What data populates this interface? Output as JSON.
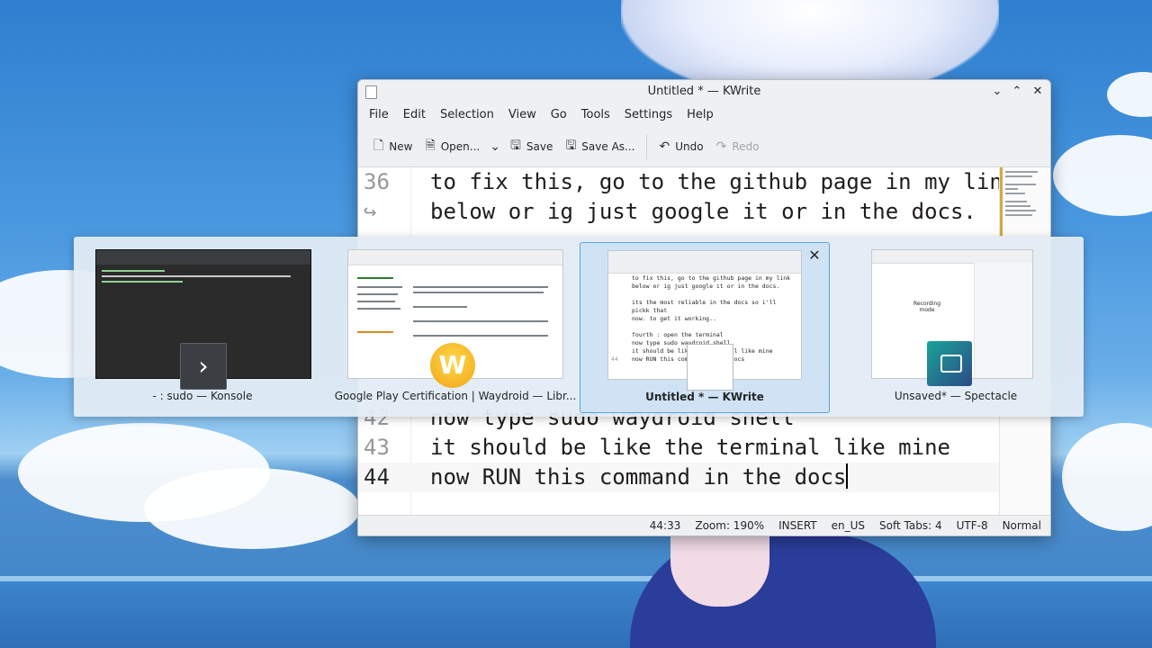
{
  "window": {
    "title": "Untitled * — KWrite",
    "menu": [
      "File",
      "Edit",
      "Selection",
      "View",
      "Go",
      "Tools",
      "Settings",
      "Help"
    ],
    "toolbar": {
      "new": "New",
      "open": "Open...",
      "save": "Save",
      "save_as": "Save As...",
      "undo": "Undo",
      "redo": "Redo"
    }
  },
  "editor": {
    "lines_top": [
      {
        "num": "36",
        "text": "to fix this, go to the github page in my link"
      },
      {
        "num": "↪",
        "text": "below or ig just google it or in the docs."
      }
    ],
    "lines_bottom": [
      {
        "num": "42",
        "text": "now type sudo waydroid shell"
      },
      {
        "num": "43",
        "text": "it should be like the terminal like mine"
      },
      {
        "num": "44",
        "text": "now RUN this command in the docs"
      }
    ]
  },
  "statusbar": {
    "position": "44:33",
    "zoom": "Zoom: 190%",
    "mode": "INSERT",
    "dictionary": "en_US",
    "tabs": "Soft Tabs: 4",
    "encoding": "UTF-8",
    "syntax": "Normal"
  },
  "switcher": {
    "tasks": [
      {
        "label": "- : sudo — Konsole"
      },
      {
        "label": "Google Play Certification | Waydroid — Libr..."
      },
      {
        "label": "Untitled * — KWrite"
      },
      {
        "label": "Unsaved* — Spectacle"
      }
    ],
    "kwrite_preview": {
      "lines": [
        {
          "num": "",
          "text": "to fix this, go to the github page in my link"
        },
        {
          "num": "",
          "text": "below or ig just google it or in the docs."
        },
        {
          "num": "",
          "text": ""
        },
        {
          "num": "",
          "text": "its the most reliable in the docs so i'll"
        },
        {
          "num": "",
          "text": "pickk that"
        },
        {
          "num": "",
          "text": "now. to get it working.."
        },
        {
          "num": "",
          "text": ""
        },
        {
          "num": "",
          "text": "fourth : open the terminal"
        },
        {
          "num": "",
          "text": "now type sudo waydroid shell"
        },
        {
          "num": "",
          "text": "it should be like the terminal like mine"
        },
        {
          "num": "44",
          "text": "now RUN this command in the docs"
        }
      ]
    },
    "spectacle_preview": {
      "text": "Recording\nmode"
    },
    "badge_icons": [
      "terminal-icon",
      "waydroid-icon",
      "kwrite-icon",
      "spectacle-icon"
    ]
  }
}
